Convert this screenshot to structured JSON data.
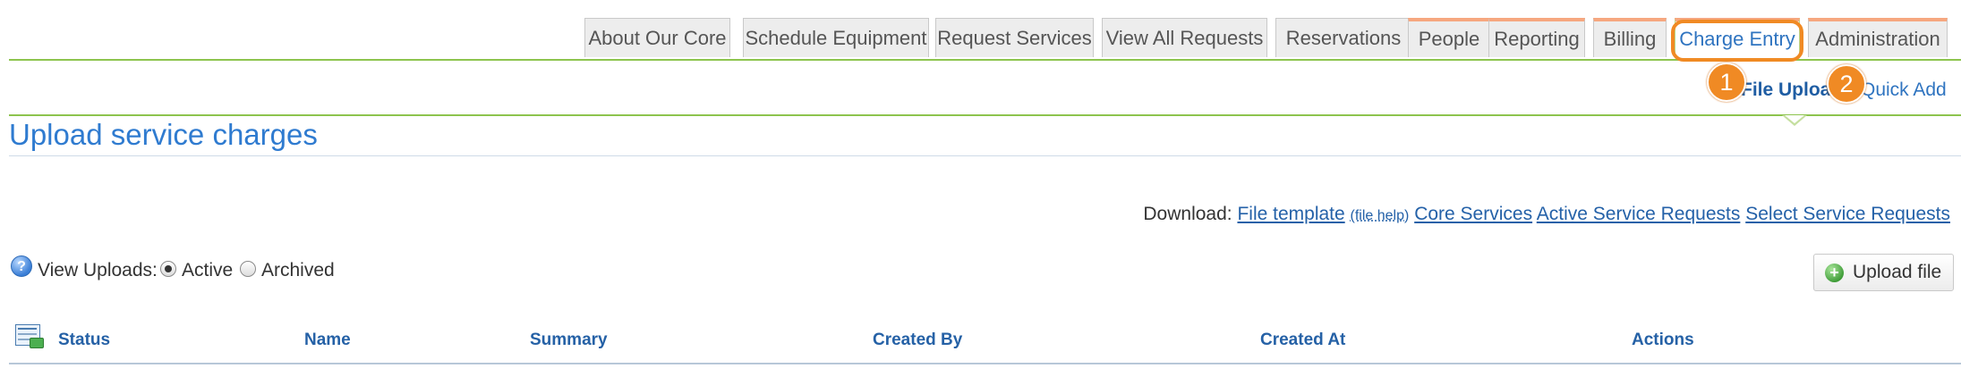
{
  "tabs": [
    {
      "label": "About Our Core"
    },
    {
      "label": "Schedule Equipment"
    },
    {
      "label": "Request Services"
    },
    {
      "label": "View All Requests"
    },
    {
      "label": "Reservations"
    },
    {
      "label": "People"
    },
    {
      "label": "Reporting"
    },
    {
      "label": "Billing"
    },
    {
      "label": "Charge Entry"
    },
    {
      "label": "Administration"
    }
  ],
  "callouts": [
    "1",
    "2"
  ],
  "subnav": {
    "file_upload": "File Upload",
    "quick_add": "Quick Add"
  },
  "page_title": "Upload service charges",
  "download": {
    "label": "Download:",
    "file_template": "File template",
    "file_help": "(file help)",
    "core_services": "Core Services",
    "active_requests": "Active Service Requests",
    "select_requests": "Select Service Requests"
  },
  "view_uploads": {
    "label": "View Uploads:",
    "active": "Active",
    "archived": "Archived",
    "selected": "Active"
  },
  "help_icon_glyph": "?",
  "upload_button": {
    "label": "Upload file"
  },
  "table": {
    "columns": [
      "Status",
      "Name",
      "Summary",
      "Created By",
      "Created At",
      "Actions"
    ]
  },
  "colors": {
    "accent_orange": "#f08a24",
    "tab_accent": "#f6a77f",
    "link_blue": "#2f74c0",
    "nav_green": "#8dc44e"
  },
  "icons": {
    "help": "help-circle-icon",
    "upload": "plus-circle-icon",
    "table": "table-settings-icon"
  }
}
